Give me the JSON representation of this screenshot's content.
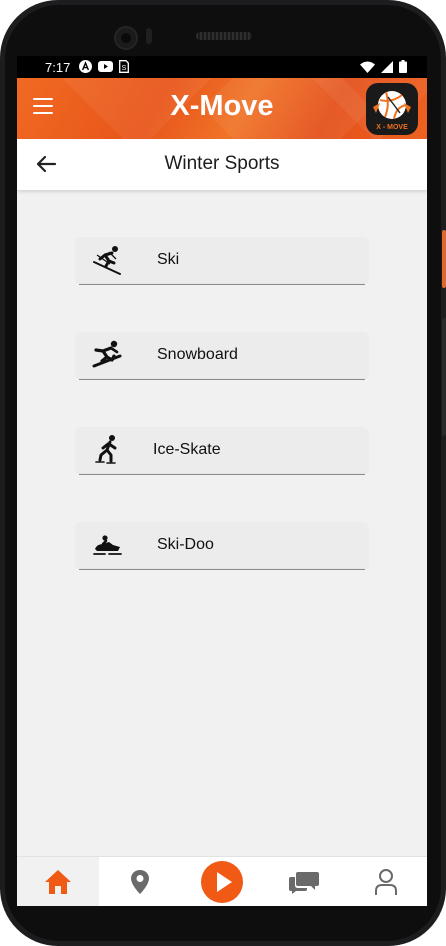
{
  "status_bar": {
    "time": "7:17"
  },
  "header": {
    "title": "X-Move",
    "logo_text": "X - MOVE",
    "brand_color": "#f06a22"
  },
  "page": {
    "title": "Winter Sports"
  },
  "sports": [
    {
      "label": "Ski",
      "icon": "skier-icon"
    },
    {
      "label": "Snowboard",
      "icon": "snowboarder-icon"
    },
    {
      "label": "Ice-Skate",
      "icon": "ice-skater-icon"
    },
    {
      "label": "Ski-Doo",
      "icon": "snowmobile-icon"
    }
  ],
  "bottom_nav": {
    "tabs": [
      {
        "name": "home",
        "icon": "home-icon",
        "active": true
      },
      {
        "name": "location",
        "icon": "location-pin-icon",
        "active": false
      },
      {
        "name": "play",
        "icon": "play-icon",
        "active": false
      },
      {
        "name": "chat",
        "icon": "chat-icon",
        "active": false
      },
      {
        "name": "profile",
        "icon": "user-icon",
        "active": false
      }
    ],
    "accent_color": "#f05a14"
  }
}
